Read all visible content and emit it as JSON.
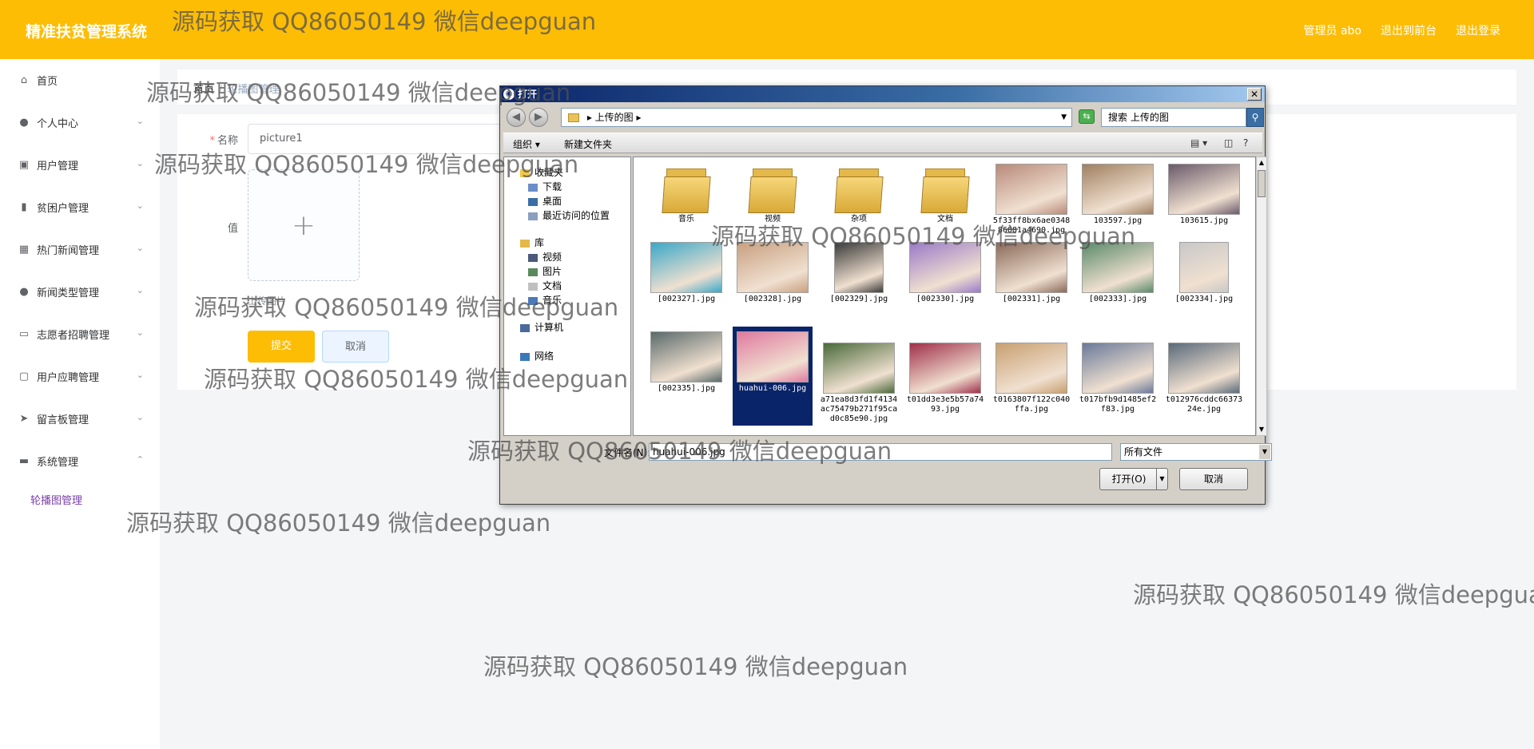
{
  "header": {
    "app_title": "精准扶贫管理系统",
    "admin_label": "管理员 abo",
    "front_link": "退出到前台",
    "logout_link": "退出登录"
  },
  "sidebar": {
    "items": [
      {
        "label": "首页",
        "icon": "home-icon",
        "glyph": "⌂",
        "chevron": ""
      },
      {
        "label": "个人中心",
        "icon": "user-icon",
        "glyph": "●",
        "chevron": "⌄"
      },
      {
        "label": "用户管理",
        "icon": "chart-icon",
        "glyph": "▣",
        "chevron": "⌄"
      },
      {
        "label": "贫困户管理",
        "icon": "bar-chart-icon",
        "glyph": "▮",
        "chevron": "⌄"
      },
      {
        "label": "热门新闻管理",
        "icon": "grid-icon",
        "glyph": "▦",
        "chevron": "⌄"
      },
      {
        "label": "新闻类型管理",
        "icon": "user-icon",
        "glyph": "●",
        "chevron": "⌄"
      },
      {
        "label": "志愿者招聘管理",
        "icon": "card-icon",
        "glyph": "▭",
        "chevron": "⌄"
      },
      {
        "label": "用户应聘管理",
        "icon": "chat-icon",
        "glyph": "▢",
        "chevron": "⌄"
      },
      {
        "label": "留言板管理",
        "icon": "send-icon",
        "glyph": "➤",
        "chevron": "⌄"
      },
      {
        "label": "系统管理",
        "icon": "box-icon",
        "glyph": "▬",
        "chevron": "⌃"
      }
    ],
    "sub_item": "轮播图管理"
  },
  "breadcrumb": {
    "home": "首页",
    "current": "轮播图管理"
  },
  "form": {
    "name_label": "名称",
    "name_value": "picture1",
    "value_label": "值",
    "upload_plus": "+",
    "upload_tip": "上传图片",
    "submit_label": "提交",
    "cancel_label": "取消"
  },
  "watermark": "源码获取 QQ86050149 微信deepguan",
  "dialog": {
    "title": "打开",
    "close": "✕",
    "address": "上传的图",
    "search_placeholder": "搜索 上传的图",
    "toolbar_organize": "组织",
    "toolbar_new_folder": "新建文件夹",
    "tree": [
      {
        "label": "收藏夹",
        "color": "#f2c94c"
      },
      {
        "label": "下载",
        "color": "#6a8fc8"
      },
      {
        "label": "桌面",
        "color": "#3a6ea5"
      },
      {
        "label": "最近访问的位置",
        "color": "#8aa0c0"
      },
      {
        "label": "库",
        "color": "#e4b84a"
      },
      {
        "label": "视频",
        "color": "#4a5a7a"
      },
      {
        "label": "图片",
        "color": "#5a8a5a"
      },
      {
        "label": "文档",
        "color": "#c0c0c0"
      },
      {
        "label": "音乐",
        "color": "#4a7ab8"
      },
      {
        "label": "计算机",
        "color": "#4a6a9a"
      },
      {
        "label": "网络",
        "color": "#3a7ab8"
      }
    ],
    "files": [
      {
        "name": "音乐",
        "type": "folder"
      },
      {
        "name": "视频",
        "type": "folder"
      },
      {
        "name": "杂项",
        "type": "folder"
      },
      {
        "name": "文档",
        "type": "folder"
      },
      {
        "name": "5f33ff8bx6ae034886081a4690.jpg",
        "type": "image",
        "color": "#b88a7a"
      },
      {
        "name": "103597.jpg",
        "type": "image",
        "color": "#a08060"
      },
      {
        "name": "103615.jpg",
        "type": "image",
        "color": "#6a5a6a"
      },
      {
        "name": "[002327].jpg",
        "type": "image",
        "color": "#3aa8c8"
      },
      {
        "name": "[002328].jpg",
        "type": "image",
        "color": "#c8a080"
      },
      {
        "name": "[002329].jpg",
        "type": "image",
        "color": "#3a3a3a"
      },
      {
        "name": "[002330].jpg",
        "type": "image",
        "color": "#9a7ac8"
      },
      {
        "name": "[002331].jpg",
        "type": "image",
        "color": "#8a6a5a"
      },
      {
        "name": "[002333].jpg",
        "type": "image",
        "color": "#5a8a6a"
      },
      {
        "name": "[002334].jpg",
        "type": "image",
        "color": "#c8c8c8"
      },
      {
        "name": "[002335].jpg",
        "type": "image",
        "color": "#5a6a6a"
      },
      {
        "name": "huahui-006.jpg",
        "type": "image",
        "color": "#e07aa0",
        "selected": true
      },
      {
        "name": "a71ea8d3fd1f4134ac75479b271f95cad0c85e90.jpg",
        "type": "image",
        "color": "#4a6a3a"
      },
      {
        "name": "t01dd3e3e5b57a7493.jpg",
        "type": "image",
        "color": "#a0304a"
      },
      {
        "name": "t0163807f122c040ffa.jpg",
        "type": "image",
        "color": "#c8a070"
      },
      {
        "name": "t017bfb9d1485ef2f83.jpg",
        "type": "image",
        "color": "#6a7a9a"
      },
      {
        "name": "t012976cddc6637324e.jpg",
        "type": "image",
        "color": "#5a6a7a"
      }
    ],
    "filename_label": "文件名(N):",
    "filename_value": "huahui-006.jpg",
    "filetype_value": "所有文件",
    "open_button": "打开(O)",
    "cancel_button": "取消"
  }
}
